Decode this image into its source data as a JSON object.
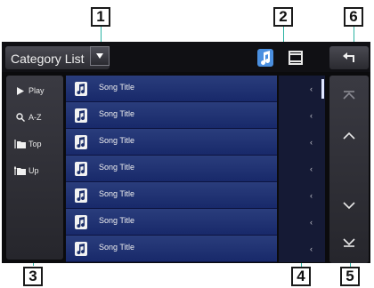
{
  "callouts": {
    "c1": "1",
    "c2": "2",
    "c3": "3",
    "c4": "4",
    "c5": "5",
    "c6": "6"
  },
  "header": {
    "title": "Category List"
  },
  "side_buttons": [
    {
      "label": "Play",
      "icon": "play-icon"
    },
    {
      "label": "A-Z",
      "icon": "search-icon"
    },
    {
      "label": "Top",
      "icon": "folder-top-icon"
    },
    {
      "label": "Up",
      "icon": "folder-up-icon"
    }
  ],
  "list": {
    "rows": [
      {
        "title": "Song Title",
        "marker": "‹"
      },
      {
        "title": "Song Title",
        "marker": "‹"
      },
      {
        "title": "Song Title",
        "marker": "‹"
      },
      {
        "title": "Song Title",
        "marker": "‹"
      },
      {
        "title": "Song Title",
        "marker": "‹"
      },
      {
        "title": "Song Title",
        "marker": "‹"
      },
      {
        "title": "Song Title",
        "marker": "‹"
      }
    ]
  },
  "colors": {
    "accent": "#2bb3a3",
    "list_bg": "#1c2f6b",
    "note_active": "#4a8fe0"
  },
  "icons": {
    "dropdown": "caret-down-icon",
    "music_mode": "music-note-icon",
    "video_mode": "film-icon",
    "back": "back-arrow-icon",
    "page": [
      "jump-top-icon",
      "page-up-icon",
      "page-down-icon",
      "jump-bottom-icon"
    ]
  }
}
